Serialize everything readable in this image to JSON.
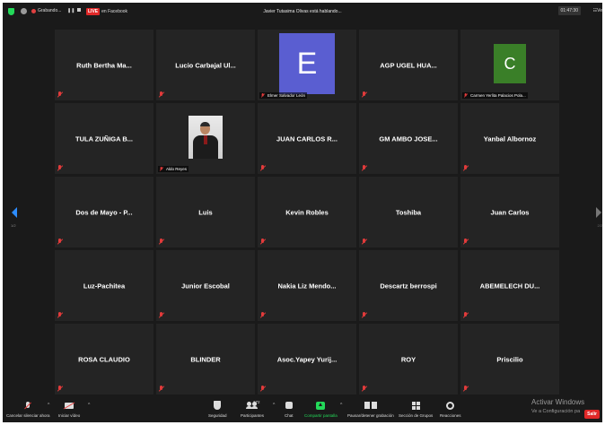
{
  "topbar": {
    "recording_label": "Grabando...",
    "live_badge": "LIVE",
    "live_label": "en Facebook",
    "talking": "Javier Tutasima Olivas está hablando...",
    "clock": "01:47:30",
    "view_label": "Ve"
  },
  "tiles": [
    {
      "name": "Ruth Bertha Ma...",
      "label": ""
    },
    {
      "name": "Lucio Carbajal Ul...",
      "label": ""
    },
    {
      "name": "",
      "label": "Elmer Salvador León",
      "avatar_letter": "E",
      "avatar_color": "#5a5ed1"
    },
    {
      "name": "AGP UGEL HUA...",
      "label": ""
    },
    {
      "name": "",
      "label": "Carmen Yerlita Palacios Pola...",
      "avatar_letter": "C",
      "avatar_color": "#3a7f28"
    },
    {
      "name": "TULA ZUÑIGA B...",
      "label": ""
    },
    {
      "name": "",
      "label": "Aldo Reyes",
      "has_photo": true
    },
    {
      "name": "JUAN CARLOS R...",
      "label": ""
    },
    {
      "name": "GM AMBO JOSE...",
      "label": ""
    },
    {
      "name": "Yanbal Albornoz",
      "label": ""
    },
    {
      "name": "Dos de Mayo - P...",
      "label": ""
    },
    {
      "name": "Luis",
      "label": ""
    },
    {
      "name": "Kevin Robles",
      "label": ""
    },
    {
      "name": "Toshiba",
      "label": ""
    },
    {
      "name": "Juan Carlos",
      "label": ""
    },
    {
      "name": "Luz-Pachitea",
      "label": ""
    },
    {
      "name": "Junior Escobal",
      "label": ""
    },
    {
      "name": "Nakia Liz Mendo...",
      "label": ""
    },
    {
      "name": "Descartz berrospi",
      "label": ""
    },
    {
      "name": "ABEMELECH DU...",
      "label": ""
    },
    {
      "name": "ROSA CLAUDIO",
      "label": ""
    },
    {
      "name": "BLINDER",
      "label": ""
    },
    {
      "name": "Asoc.Yapey Yurij...",
      "label": ""
    },
    {
      "name": "ROY",
      "label": ""
    },
    {
      "name": "Priscilio",
      "label": ""
    }
  ],
  "nav": {
    "page_left": "1/2",
    "page_right": "2/2"
  },
  "toolbar": {
    "unmute": "Cancelar silenciar ahora",
    "video": "Iniciar vídeo",
    "security": "Seguridad",
    "participants": "Participantes",
    "participants_count": "172",
    "chat": "Chat",
    "share": "Compartir pantalla",
    "record": "Pausar/detener grabación",
    "rooms": "Sección de Grupos",
    "reactions": "Reacciones",
    "leave": "Salir"
  },
  "watermark": {
    "title": "Activar Windows",
    "subtitle": "Ve a Configuración pa"
  },
  "colors": {
    "accent_green": "#23d959",
    "muted_red": "#e23b3b",
    "nav_blue": "#2d8cff"
  }
}
